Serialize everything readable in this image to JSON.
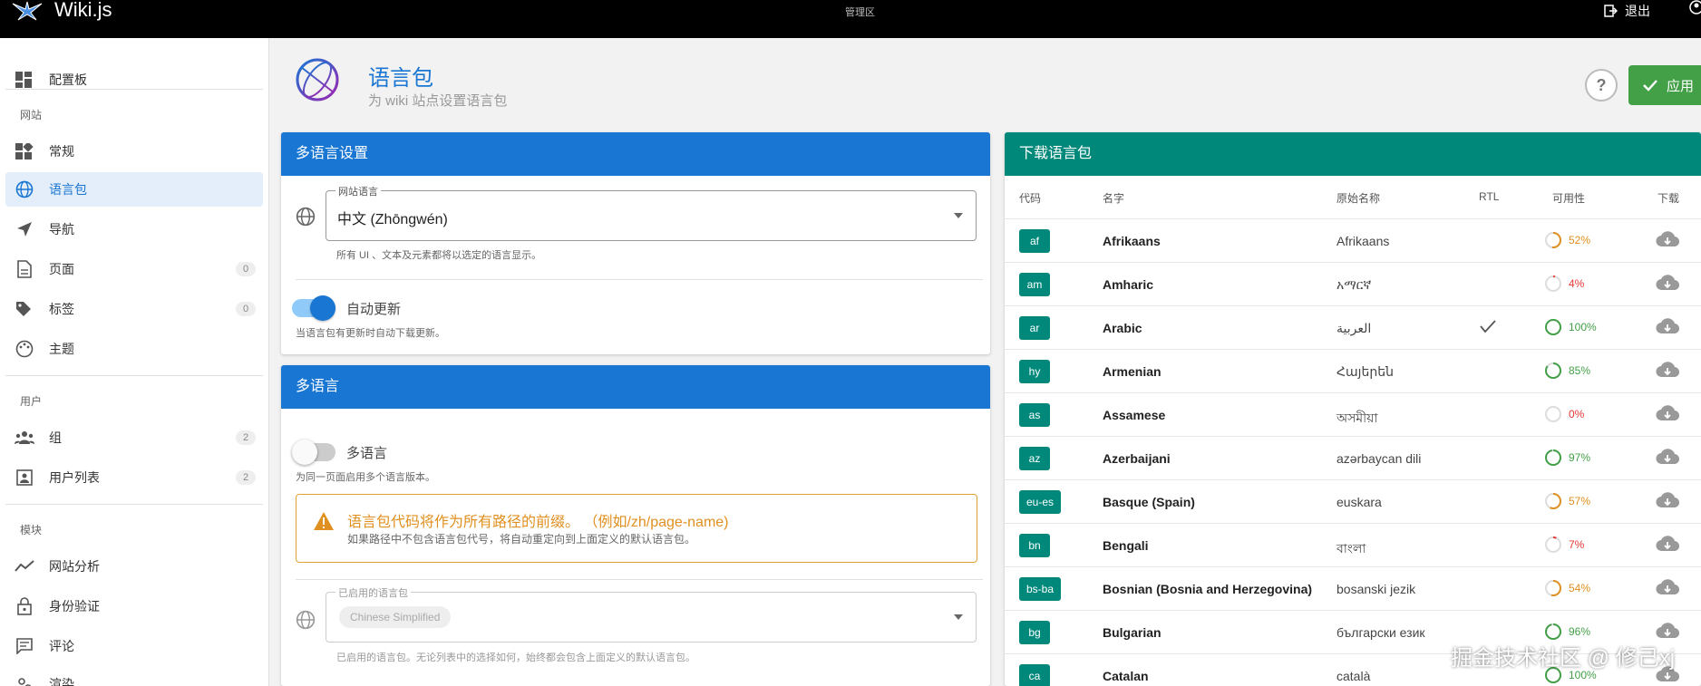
{
  "topbar": {
    "title": "Wiki.js",
    "admin_label": "管理区",
    "logout_label": "退出"
  },
  "sidebar": {
    "items": [
      {
        "label": "配置板",
        "icon": "dashboard-icon"
      },
      {
        "label": "常规",
        "icon": "widgets-icon"
      },
      {
        "label": "语言包",
        "icon": "globe-icon"
      },
      {
        "label": "导航",
        "icon": "navigation-icon"
      },
      {
        "label": "页面",
        "icon": "page-icon",
        "count": "0"
      },
      {
        "label": "标签",
        "icon": "tags-icon",
        "count": "0"
      },
      {
        "label": "主题",
        "icon": "palette-icon"
      },
      {
        "label": "组",
        "icon": "groups-icon",
        "count": "2"
      },
      {
        "label": "用户列表",
        "icon": "user-list-icon",
        "count": "2"
      },
      {
        "label": "网站分析",
        "icon": "analytics-icon"
      },
      {
        "label": "身份验证",
        "icon": "lock-icon"
      },
      {
        "label": "评论",
        "icon": "comment-icon"
      },
      {
        "label": "渲染",
        "icon": "render-icon"
      }
    ],
    "sections": {
      "site": "网站",
      "users": "用户",
      "modules": "模块"
    }
  },
  "header": {
    "title": "语言包",
    "subtitle": "为 wiki 站点设置语言包",
    "apply_label": "应用",
    "help_label": "?"
  },
  "locale_card": {
    "title": "多语言设置",
    "site_locale_legend": "网站语言",
    "site_locale_value": "中文 (Zhōngwén)",
    "site_locale_hint": "所有 UI 、文本及元素都将以选定的语言显示。",
    "auto_update_label": "自动更新",
    "auto_update_on": true,
    "auto_update_hint": "当语言包有更新时自动下载更新。"
  },
  "namespacing_card": {
    "title": "多语言",
    "toggle_label": "多语言",
    "toggle_on": false,
    "toggle_hint": "为同一页面启用多个语言版本。",
    "alert_title": "语言包代码将作为所有路径的前缀。 （例如/zh/page-name)",
    "alert_text": "如果路径中不包含语言包代号，将自动重定向到上面定义的默认语言包。",
    "active_legend": "已启用的语言包",
    "active_chip": "Chinese Simplified",
    "active_hint": "已启用的语言包。无论列表中的选择如何，始终都会包含上面定义的默认语言包。"
  },
  "download_card": {
    "title": "下载语言包",
    "columns": {
      "code": "代码",
      "name": "名字",
      "native": "原始名称",
      "rtl": "RTL",
      "availability": "可用性",
      "download": "下载"
    },
    "rows": [
      {
        "code": "af",
        "name": "Afrikaans",
        "native": "Afrikaans",
        "rtl": false,
        "availability": 52
      },
      {
        "code": "am",
        "name": "Amharic",
        "native": "አማርኛ",
        "rtl": false,
        "availability": 4
      },
      {
        "code": "ar",
        "name": "Arabic",
        "native": "العربية",
        "rtl": true,
        "availability": 100
      },
      {
        "code": "hy",
        "name": "Armenian",
        "native": "Հայերեն",
        "rtl": false,
        "availability": 85
      },
      {
        "code": "as",
        "name": "Assamese",
        "native": "অসমীয়া",
        "rtl": false,
        "availability": 0
      },
      {
        "code": "az",
        "name": "Azerbaijani",
        "native": "azərbaycan dili",
        "rtl": false,
        "availability": 97
      },
      {
        "code": "eu-es",
        "name": "Basque (Spain)",
        "native": "euskara",
        "rtl": false,
        "availability": 57
      },
      {
        "code": "bn",
        "name": "Bengali",
        "native": "বাংলা",
        "rtl": false,
        "availability": 7
      },
      {
        "code": "bs-ba",
        "name": "Bosnian (Bosnia and Herzegovina)",
        "native": "bosanski jezik",
        "rtl": false,
        "availability": 54
      },
      {
        "code": "bg",
        "name": "Bulgarian",
        "native": "български език",
        "rtl": false,
        "availability": 96
      },
      {
        "code": "ca",
        "name": "Catalan",
        "native": "català",
        "rtl": false,
        "availability": 100
      }
    ]
  },
  "colors": {
    "primary": "#1976d2",
    "teal": "#00897b",
    "success": "#43a047",
    "warning": "#e09020",
    "danger": "#e53935",
    "good": "#43a047"
  },
  "watermark": "掘金技术社区 @ 修己xj"
}
